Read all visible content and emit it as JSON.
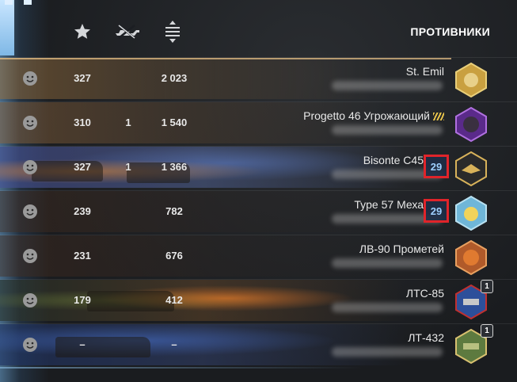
{
  "header": {
    "title": "ПРОТИВНИКИ",
    "icons": [
      "star-icon",
      "tank-destroyed-icon",
      "damage-arrows-icon"
    ]
  },
  "rows": [
    {
      "style": "first",
      "score": "327",
      "kills": "",
      "damage": "2 023",
      "tank": "St. Emil",
      "level_badge": "",
      "avatar_color": "#c9a040",
      "avatar_count": ""
    },
    {
      "style": "tan",
      "score": "310",
      "kills": "1",
      "damage": "1 540",
      "tank": "Progetto 46 Угрожающий",
      "level_badge": "",
      "avatar_color": "#7a3fb0",
      "avatar_count": ""
    },
    {
      "style": "scene-blue",
      "score": "327",
      "kills": "1",
      "damage": "1 366",
      "tank": "Bisonte C45",
      "level_badge": "29",
      "avatar_color": "#d8b25a",
      "avatar_count": ""
    },
    {
      "style": "plain",
      "score": "239",
      "kills": "",
      "damage": "782",
      "tank": "Type 57 Меха",
      "level_badge": "29",
      "avatar_color": "#6fb6d8",
      "avatar_count": ""
    },
    {
      "style": "plain",
      "score": "231",
      "kills": "",
      "damage": "676",
      "tank": "ЛВ-90 Прометей",
      "level_badge": "",
      "avatar_color": "#d07a3a",
      "avatar_count": ""
    },
    {
      "style": "fire",
      "score": "179",
      "kills": "",
      "damage": "412",
      "tank": "ЛТС-85",
      "level_badge": "",
      "avatar_color": "#3b6fc0",
      "avatar_count": "1"
    },
    {
      "style": "night",
      "score": "–",
      "kills": "",
      "damage": "–",
      "tank": "ЛТ-432",
      "level_badge": "",
      "avatar_color": "#7a9a55",
      "avatar_count": "1"
    }
  ]
}
